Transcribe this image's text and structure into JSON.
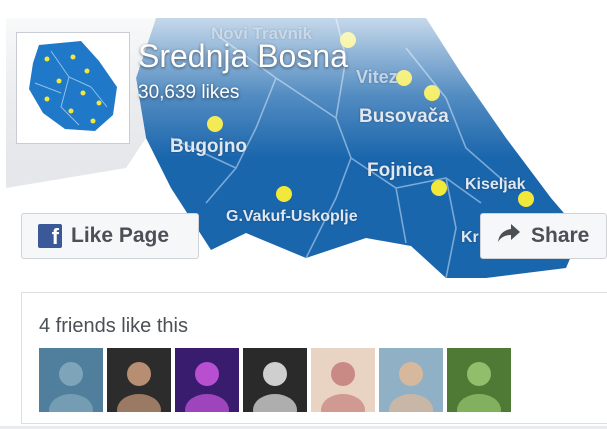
{
  "page": {
    "name": "Srednja Bosna",
    "likes_text": "30,639 likes"
  },
  "map_labels": {
    "novi_travnik": "Novi Travnik",
    "vitez": "Vitez",
    "busovaca": "Busovača",
    "bugojno": "Bugojno",
    "fojnica": "Fojnica",
    "kiseljak": "Kiseljak",
    "gvakuf": "G.Vakuf-Uskoplje",
    "kr": "Kr"
  },
  "buttons": {
    "like_label": "Like Page",
    "share_label": "Share"
  },
  "friends": {
    "text": "4 friends like this",
    "photos": [
      {
        "name": "friend-photo-1",
        "colors": [
          "#4f7f9c",
          "#7da4b8"
        ]
      },
      {
        "name": "friend-photo-2",
        "colors": [
          "#2c2c2c",
          "#b88e73"
        ]
      },
      {
        "name": "friend-photo-3",
        "colors": [
          "#3a1c6e",
          "#b84fd1"
        ]
      },
      {
        "name": "friend-photo-4",
        "colors": [
          "#2a2a2a",
          "#cfcfcf"
        ]
      },
      {
        "name": "friend-photo-5",
        "colors": [
          "#e9d4c4",
          "#c98a86"
        ]
      },
      {
        "name": "friend-photo-6",
        "colors": [
          "#8fb0c5",
          "#d6b99d"
        ]
      },
      {
        "name": "friend-photo-7",
        "colors": [
          "#4e7a35",
          "#8fbf6a"
        ]
      }
    ]
  },
  "colors": {
    "map_blue": "#1a66ad",
    "map_border": "#7aa9d6",
    "marker_yellow": "#f1e83a",
    "facebook_blue": "#3b5998"
  },
  "icons": {
    "facebook": "facebook-f-icon",
    "share": "share-arrow-icon"
  }
}
